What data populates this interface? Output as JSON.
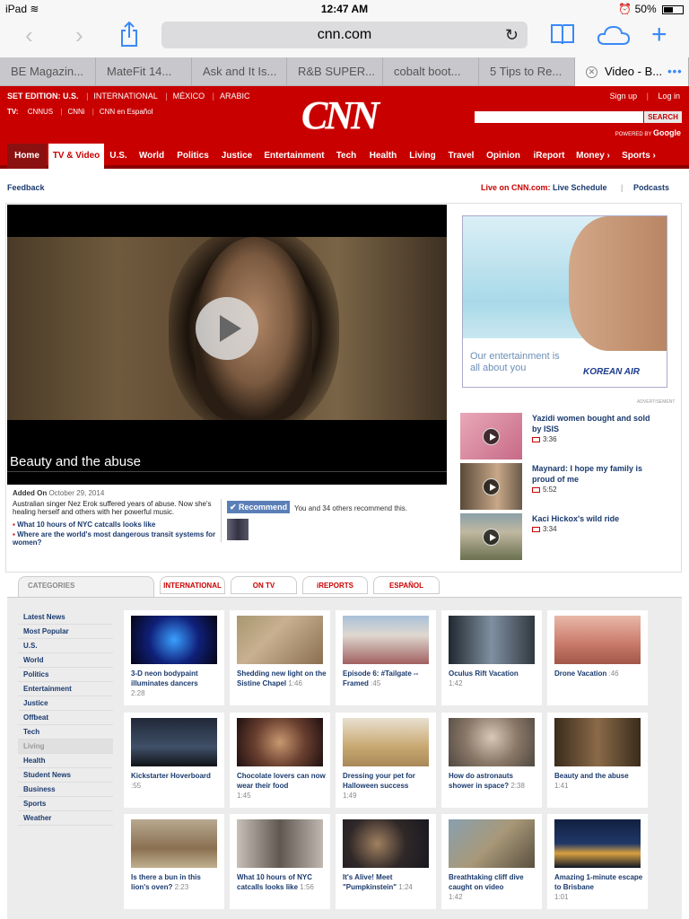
{
  "status": {
    "device": "iPad",
    "time": "12:47 AM",
    "battery": "50%",
    "battery_level": 0.5
  },
  "browser": {
    "url": "cnn.com",
    "tabs": [
      "BE Magazin...",
      "MateFit 14...",
      "Ask and It Is...",
      "R&B SUPER...",
      "cobalt boot...",
      "5 Tips to Re...",
      "Video - B..."
    ]
  },
  "cnn": {
    "edition_label": "SET EDITION:",
    "edition_current": "U.S.",
    "editions": [
      "INTERNATIONAL",
      "MÉXICO",
      "ARABIC"
    ],
    "tv_label": "TV:",
    "tv_links": [
      "CNNUS",
      "CNNi",
      "CNN en Español"
    ],
    "logo": "CNN",
    "signup": "Sign up",
    "login": "Log in",
    "search_button": "SEARCH",
    "powered_by": "POWERED BY",
    "google": "Google",
    "nav": [
      "Home",
      "TV & Video",
      "U.S.",
      "World",
      "Politics",
      "Justice",
      "Entertainment",
      "Tech",
      "Health",
      "Living",
      "Travel",
      "Opinion",
      "iReport",
      "Money ›",
      "Sports ›"
    ]
  },
  "subbar": {
    "feedback": "Feedback",
    "live_prefix": "Live on CNN.com:",
    "live_link": "Live Schedule",
    "separator": "|",
    "podcasts": "Podcasts"
  },
  "video": {
    "title": "Beauty and the abuse",
    "added_label": "Added On",
    "added_date": "October 29, 2014",
    "description": "Australian singer Nez Erok suffered years of abuse. Now she's healing herself and others with her powerful music.",
    "related": [
      "What 10 hours of NYC catcalls looks like",
      "Where are the world's most dangerous transit systems for women?"
    ],
    "recommend": "Recommend",
    "recommend_text": "You and 34 others recommend this."
  },
  "ad": {
    "tagline_1": "Our entertainment is",
    "tagline_2": "all about you",
    "brand": "KOREAN AIR",
    "label": "ADVERTISEMENT"
  },
  "side_videos": [
    {
      "title": "Yazidi women bought and sold by ISIS",
      "duration": "3:36"
    },
    {
      "title": "Maynard: I hope my family is proud of me",
      "duration": "5:52"
    },
    {
      "title": "Kaci Hickox's wild ride",
      "duration": "3:34"
    }
  ],
  "category_tabs": [
    "CATEGORIES",
    "INTERNATIONAL",
    "ON TV",
    "iREPORTS",
    "ESPAÑOL"
  ],
  "categories": [
    "Latest News",
    "Most Popular",
    "U.S.",
    "World",
    "Politics",
    "Entertainment",
    "Justice",
    "Offbeat",
    "Tech",
    "Living",
    "Health",
    "Student News",
    "Business",
    "Sports",
    "Weather"
  ],
  "grid": [
    {
      "title": "3-D neon bodypaint illuminates dancers",
      "duration": "2:28"
    },
    {
      "title": "Shedding new light on the Sistine Chapel",
      "duration": "1:46"
    },
    {
      "title": "Episode 6: #Tailgate -- Framed",
      "duration": ":45"
    },
    {
      "title": "Oculus Rift Vacation",
      "duration": "1:42"
    },
    {
      "title": "Drone Vacation",
      "duration": ":46"
    },
    {
      "title": "Kickstarter Hoverboard",
      "duration": ":55"
    },
    {
      "title": "Chocolate lovers can now wear their food",
      "duration": "1:45"
    },
    {
      "title": "Dressing your pet for Halloween success",
      "duration": "1:49"
    },
    {
      "title": "How do astronauts shower in space?",
      "duration": "2:38"
    },
    {
      "title": "Beauty and the abuse",
      "duration": "1:41"
    },
    {
      "title": "Is there a bun in this lion's oven?",
      "duration": "2:23"
    },
    {
      "title": "What 10 hours of NYC catcalls looks like",
      "duration": "1:56"
    },
    {
      "title": "It's Alive! Meet \"Pumpkinstein\"",
      "duration": "1:24"
    },
    {
      "title": "Breathtaking cliff dive caught on video",
      "duration": "1:42"
    },
    {
      "title": "Amazing 1-minute escape to Brisbane",
      "duration": "1:01"
    }
  ]
}
